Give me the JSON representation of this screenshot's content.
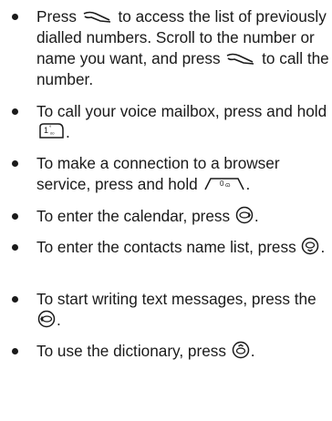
{
  "page": {
    "background": "#ffffff",
    "text_color": "#1a1a1a"
  },
  "items": [
    {
      "parts": [
        "Press ",
        " to access the list of previously dialled numbers. Scroll to the number or name you want, and press ",
        " to call the number."
      ],
      "icons": [
        "call-key-icon",
        "call-key-icon"
      ]
    },
    {
      "parts": [
        "To call your voice mailbox, press and hold ",
        "."
      ],
      "icons": [
        "key-1-voicemail-icon"
      ]
    },
    {
      "parts": [
        "To make a connection to a browser service, press and hold ",
        "."
      ],
      "icons": [
        "key-0-browser-icon"
      ]
    },
    {
      "parts": [
        "To enter the calendar, press ",
        "."
      ],
      "icons": [
        "scroll-right-icon"
      ]
    },
    {
      "parts": [
        "To enter the contacts name list, press ",
        "."
      ],
      "icons": [
        "scroll-down-icon"
      ]
    },
    {
      "parts": [
        "To start writing text messages, press the ",
        "."
      ],
      "icons": [
        "scroll-left-icon"
      ]
    },
    {
      "parts": [
        "To use the dictionary, press ",
        "."
      ],
      "icons": [
        "scroll-up-icon"
      ]
    }
  ]
}
